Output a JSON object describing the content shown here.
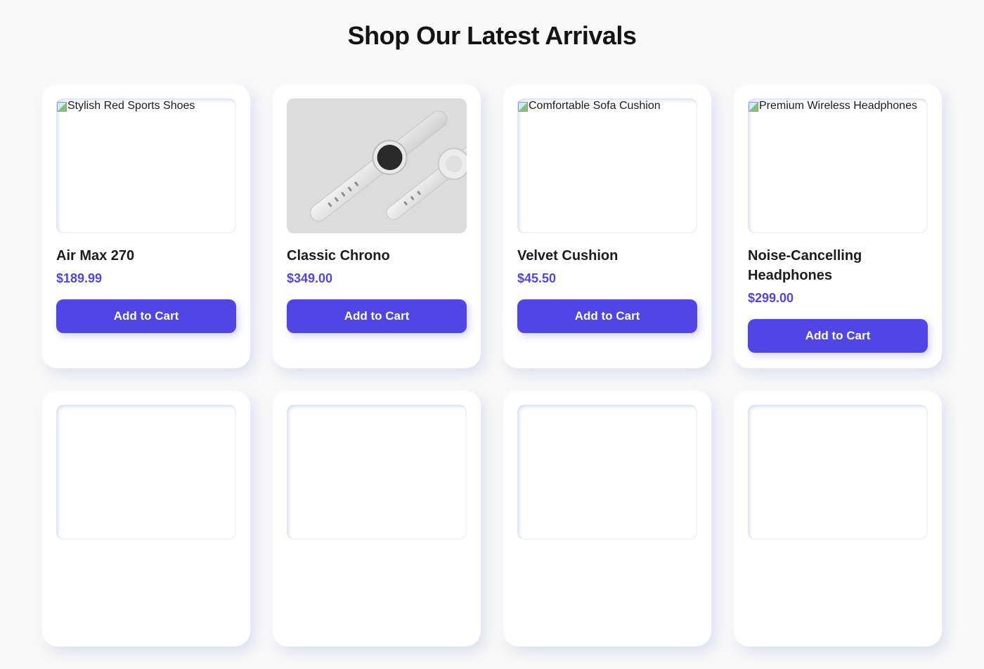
{
  "page": {
    "title": "Shop Our Latest Arrivals"
  },
  "products": [
    {
      "image_alt": "Stylish Red Sports Shoes",
      "name": "Air Max 270",
      "price": "$189.99",
      "button": "Add to Cart"
    },
    {
      "image_alt": "",
      "name": "Classic Chrono",
      "price": "$349.00",
      "button": "Add to Cart"
    },
    {
      "image_alt": "Comfortable Sofa Cushion",
      "name": "Velvet Cushion",
      "price": "$45.50",
      "button": "Add to Cart"
    },
    {
      "image_alt": "Premium Wireless Headphones",
      "name": "Noise-Cancelling Headphones",
      "price": "$299.00",
      "button": "Add to Cart"
    }
  ],
  "colors": {
    "accent": "#4f46e5",
    "background": "#f8f8f8",
    "card": "#ffffff"
  },
  "icons": {
    "broken_image": "broken-image-icon"
  }
}
